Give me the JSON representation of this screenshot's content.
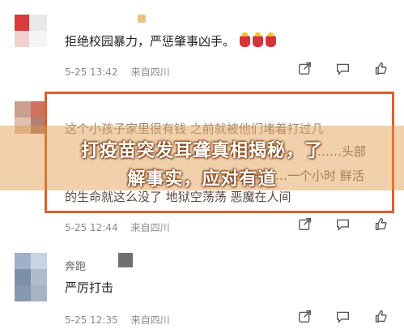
{
  "comments": [
    {
      "text": "拒绝校园暴力，严惩肇事凶手。",
      "emoji": [
        "candle",
        "candle",
        "candle"
      ],
      "date": "5-25 13:42",
      "source": "来自四川"
    },
    {
      "text_line1": "这个小孩子家里很有钱 之前就被他们堵着打过几",
      "text_line2": "……头部",
      "text_line3": "……救护车……一个小时 鲜活",
      "text_line4": "的生命就这么没了 地狱空荡荡 恶魔在人间",
      "date": "5-25 12:44",
      "source": "来自四川"
    },
    {
      "username": "奔跑",
      "text": "严厉打击",
      "date": "5-25 12:35",
      "source": "来自四川"
    }
  ],
  "headline": {
    "line1": "打疫苗突发耳聋真相揭秘，了",
    "line2": "解事实，应对有道"
  },
  "icons": [
    "reply-icon",
    "share-icon",
    "comment-icon",
    "like-icon"
  ],
  "colors": {
    "highlight_border": "#d9602e",
    "banner": "#e19646",
    "meta_text": "#8a8a8a"
  }
}
